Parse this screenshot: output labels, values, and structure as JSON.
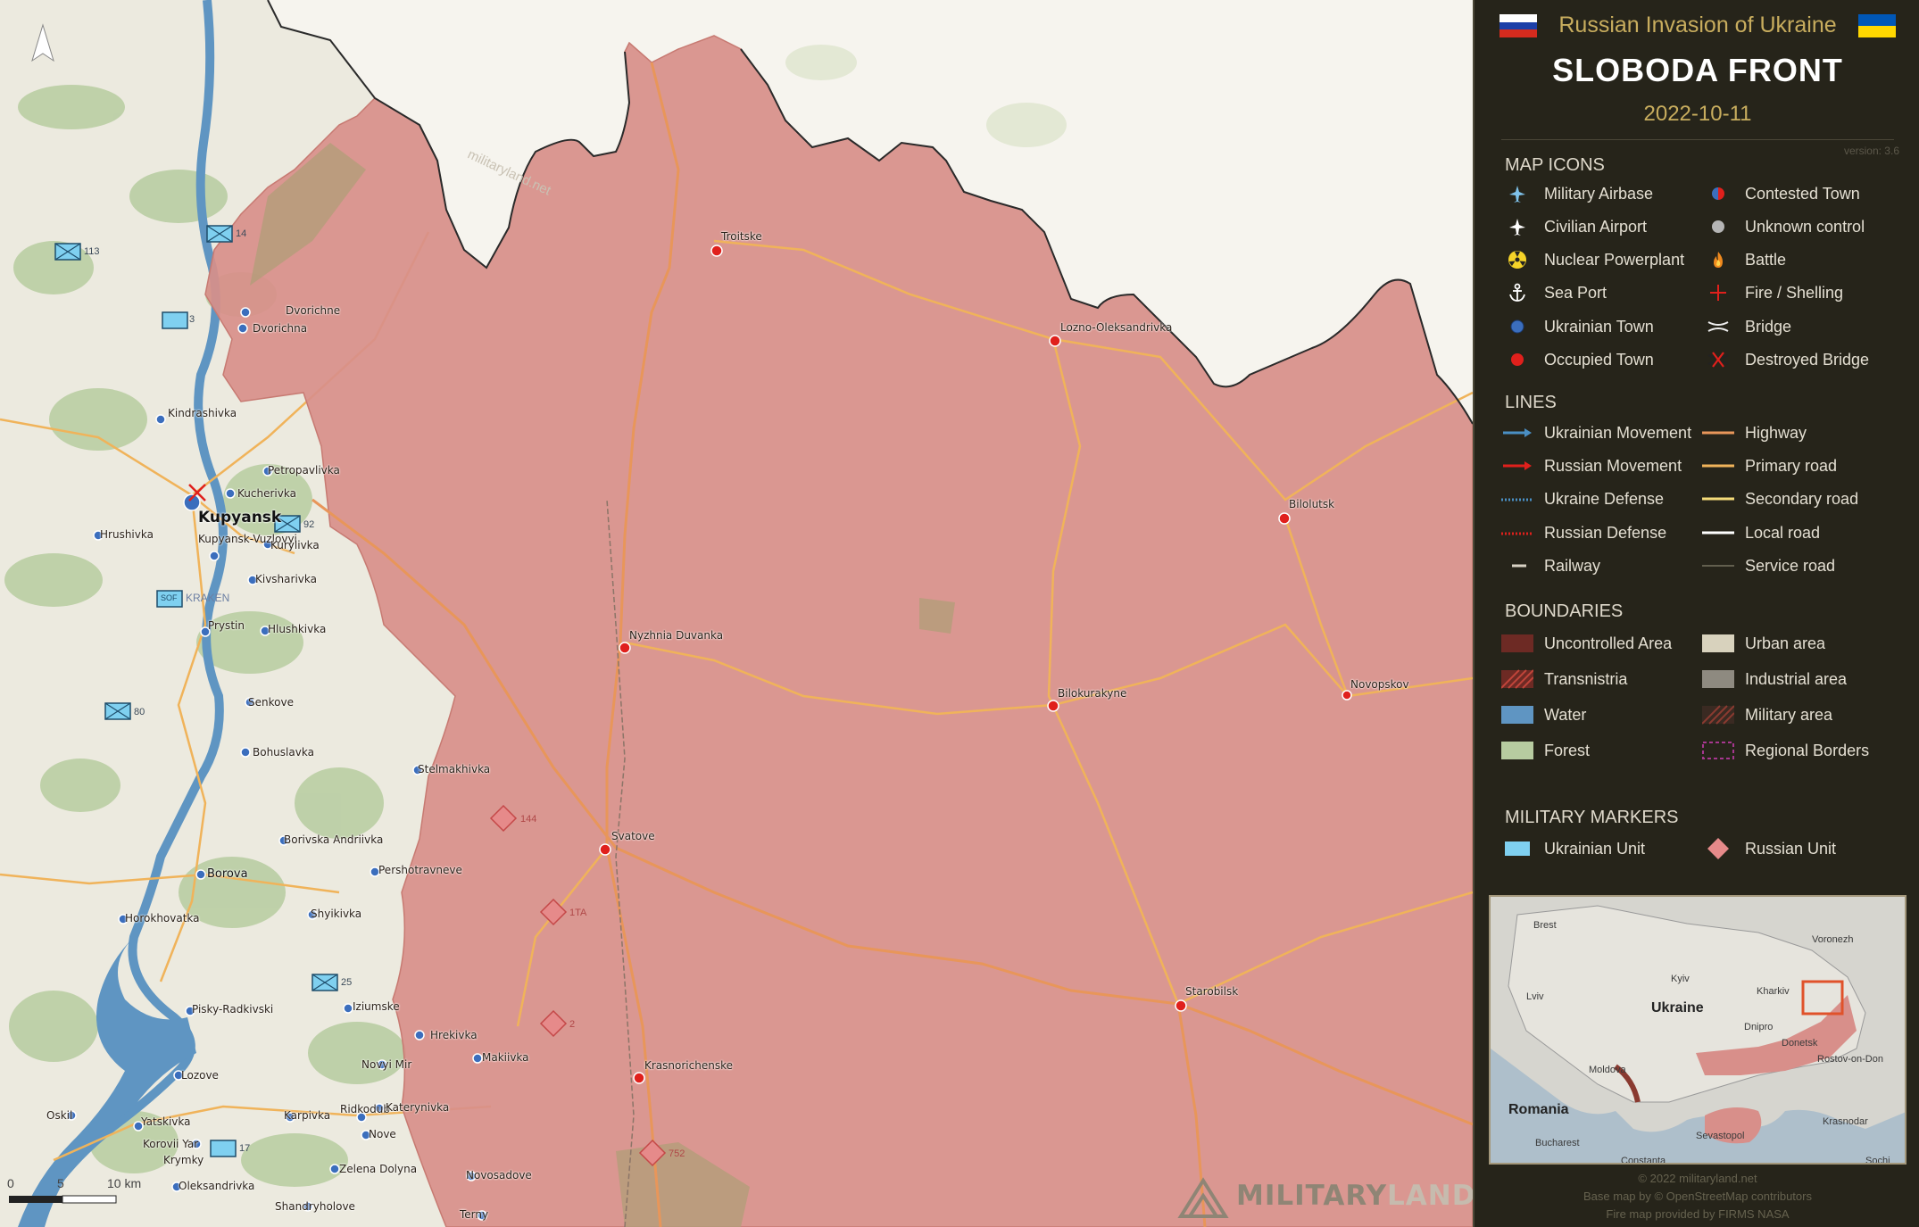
{
  "header": {
    "subtitle": "Russian Invasion of Ukraine",
    "title": "SLOBODA FRONT",
    "date": "2022-10-11",
    "version": "version: 3.6"
  },
  "legend": {
    "map_icons": {
      "title": "MAP ICONS",
      "left": [
        "Military Airbase",
        "Civilian Airport",
        "Nuclear Powerplant",
        "Sea Port",
        "Ukrainian Town",
        "Occupied Town"
      ],
      "right": [
        "Contested Town",
        "Unknown control",
        "Battle",
        "Fire / Shelling",
        "Bridge",
        "Destroyed Bridge"
      ]
    },
    "lines": {
      "title": "LINES",
      "left": [
        "Ukrainian Movement",
        "Russian Movement",
        "Ukraine Defense",
        "Russian Defense",
        "Railway"
      ],
      "right": [
        "Highway",
        "Primary road",
        "Secondary road",
        "Local road",
        "Service road"
      ]
    },
    "boundaries": {
      "title": "BOUNDARIES",
      "left": [
        "Uncontrolled Area",
        "Transnistria",
        "Water",
        "Forest"
      ],
      "right": [
        "Urban area",
        "Industrial area",
        "Military area",
        "Regional Borders"
      ]
    },
    "markers": {
      "title": "MILITARY MARKERS",
      "left": [
        "Ukrainian Unit"
      ],
      "right": [
        "Russian Unit"
      ]
    }
  },
  "colors": {
    "occupied": "#d88f8a",
    "ukrainian_town": "#3b6ebd",
    "occupied_town": "#e0201c",
    "water": "#5f95c2",
    "highway": "#e8965a",
    "primary_road": "#f0b35a",
    "panel_bg": "#26241a",
    "accent_gold": "#c8ad5e"
  },
  "map": {
    "occupied_towns": [
      "Troitske",
      "Lozno-Oleksandrivka",
      "Bilolutsk",
      "Nyzhnia Duvanka",
      "Bilokurakyne",
      "Novopskov",
      "Svatove",
      "Starobilsk",
      "Krasnorichenske"
    ],
    "ukrainian_towns": [
      "Dvorichne",
      "Dvorichna",
      "Kindrashivka",
      "Petropavlivka",
      "Kucherivka",
      "Kupyansk",
      "Hrushivka",
      "Kupyansk-Vuzlovyi",
      "Kurylivka",
      "Kivsharivka",
      "Prystin",
      "Hlushkivka",
      "Senkove",
      "Bohuslavka",
      "Stelmakhivka",
      "Borivska Andriivka",
      "Borova",
      "Pershotravneve",
      "Horokhovatka",
      "Shyikivka",
      "Pisky-Radkivski",
      "Iziumske",
      "Hrekivka",
      "Makiivka",
      "Novyi Mir",
      "Lozove",
      "Oskil",
      "Yatskivka",
      "Karpivka",
      "Ridkodub",
      "Katerynivka",
      "Korovii Yar",
      "Nove",
      "Krymky",
      "Zelena Dolyna",
      "Novosadove",
      "Oleksandrivka",
      "Shandryholove",
      "Terny"
    ],
    "other_labels": {
      "kraken": "KRAKEN",
      "sof": "SOF",
      "watermark": "militaryland.net"
    },
    "ukr_units": [
      "113",
      "14",
      "3",
      "92",
      "80",
      "25",
      "17"
    ],
    "ru_units": [
      "144",
      "1TA",
      "2",
      "752"
    ],
    "scale": {
      "zero": "0",
      "five": "5",
      "ten": "10 km"
    },
    "brand": {
      "a": "MILITARY",
      "b": "LAND"
    }
  },
  "inset": {
    "countries": [
      "Ukraine",
      "Romania"
    ],
    "cities": [
      "Brest",
      "Voronezh",
      "Kyiv",
      "Kharkiv",
      "Lviv",
      "Dnipro",
      "Donetsk",
      "Rostov-on-Don",
      "Moldova",
      "Krasnodar",
      "Sevastopol",
      "Bucharest",
      "Constanta",
      "Sochi"
    ]
  },
  "footer": {
    "copyright": "© 2022 militaryland.net",
    "basemap": "Base map by © OpenStreetMap contributors",
    "fire": "Fire map provided by FIRMS NASA"
  }
}
